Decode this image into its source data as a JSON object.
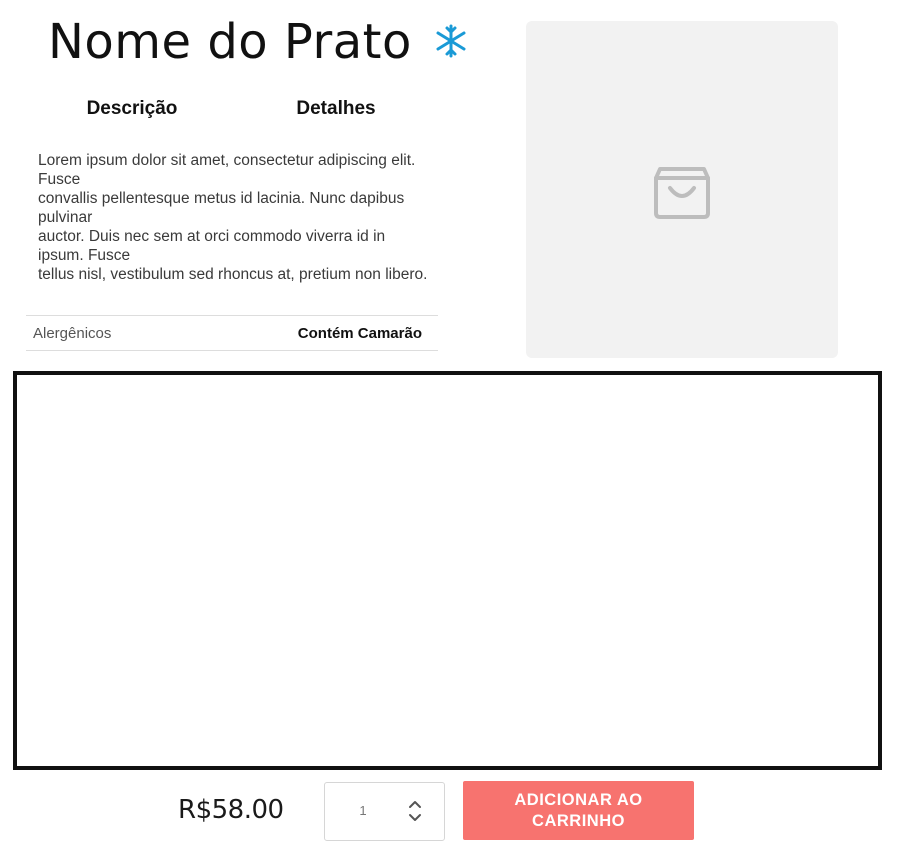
{
  "product": {
    "title": "Nome do Prato",
    "badge_icon": "snowflake-asterisk-icon",
    "badge_color": "#1a9ad6"
  },
  "tabs": [
    {
      "label": "Descrição"
    },
    {
      "label": "Detalhes"
    }
  ],
  "description": "Lorem ipsum dolor sit amet, consectetur adipiscing elit. Fusce\nconvallis pellentesque metus id lacinia. Nunc dapibus pulvinar\nauctor. Duis nec sem at orci commodo viverra id in ipsum. Fusce\ntellus nisl, vestibulum sed rhoncus at, pretium non libero.",
  "details": {
    "allergens_label": "Alergênicos",
    "allergens_value": "Contém Camarão"
  },
  "image": {
    "placeholder_icon": "shopping-bag-icon",
    "placeholder_color": "#bdbdbd"
  },
  "purchase": {
    "price": "R$58.00",
    "quantity": "1",
    "add_button_label": "ADICIONAR AO CARRINHO",
    "button_color": "#f7736f"
  }
}
